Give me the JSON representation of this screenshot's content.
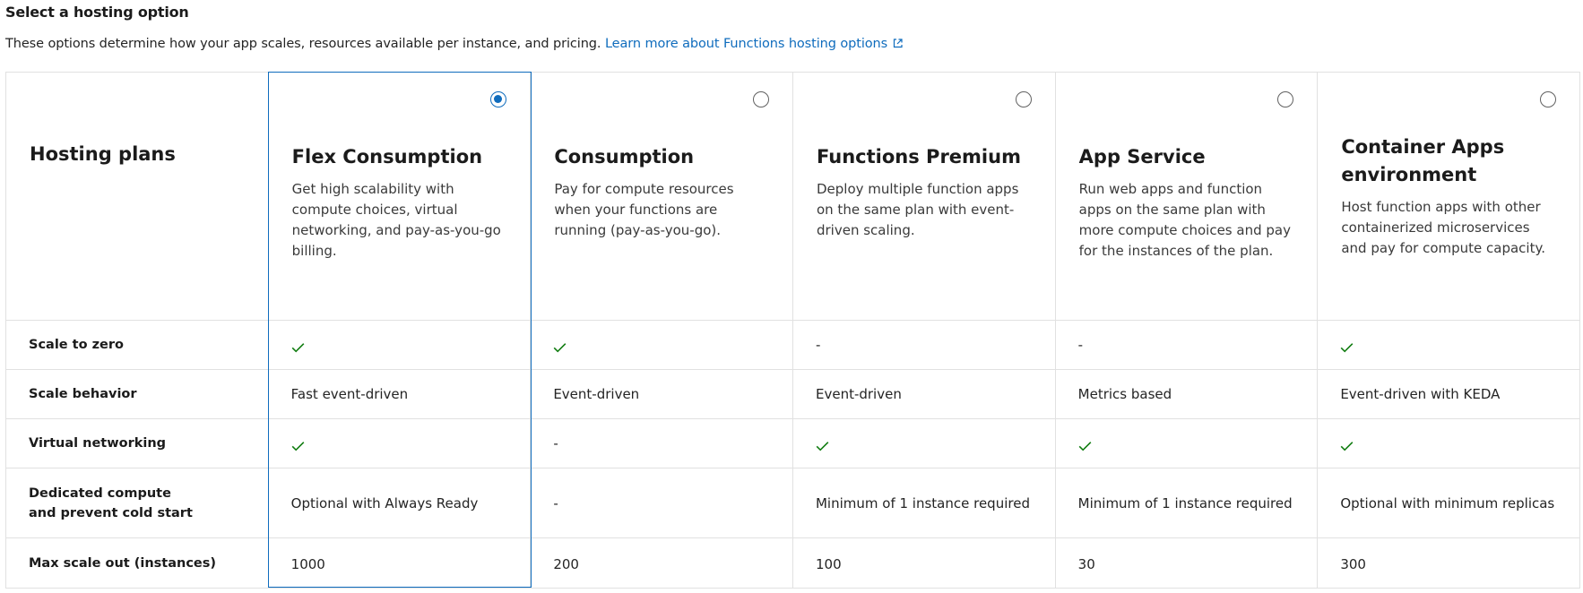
{
  "header": {
    "title": "Select a hosting option",
    "description": "These options determine how your app scales, resources available per instance, and pricing.",
    "learn_more": "Learn more about Functions hosting options"
  },
  "table": {
    "header_label": "Hosting plans",
    "row_labels": {
      "scale_to_zero": "Scale to zero",
      "scale_behavior": "Scale behavior",
      "virtual_networking": "Virtual networking",
      "dedicated_compute": "Dedicated compute and prevent cold start",
      "max_scale_out": "Max scale out (instances)"
    },
    "plans": [
      {
        "name": "Flex Consumption",
        "description": "Get high scalability with compute choices, virtual networking, and pay-as-you-go billing.",
        "selected": true,
        "scale_to_zero": "check",
        "scale_behavior": "Fast event-driven",
        "virtual_networking": "check",
        "dedicated_compute": "Optional with Always Ready",
        "max_scale_out": "1000"
      },
      {
        "name": "Consumption",
        "description": "Pay for compute resources when your functions are running (pay-as-you-go).",
        "selected": false,
        "scale_to_zero": "check",
        "scale_behavior": "Event-driven",
        "virtual_networking": "-",
        "dedicated_compute": "-",
        "max_scale_out": "200"
      },
      {
        "name": "Functions Premium",
        "description": "Deploy multiple function apps on the same plan with event-driven scaling.",
        "selected": false,
        "scale_to_zero": "-",
        "scale_behavior": "Event-driven",
        "virtual_networking": "check",
        "dedicated_compute": "Minimum of 1 instance required",
        "max_scale_out": "100"
      },
      {
        "name": "App Service",
        "description": "Run web apps and function apps on the same plan with more compute choices and pay for the instances of the plan.",
        "selected": false,
        "scale_to_zero": "-",
        "scale_behavior": "Metrics based",
        "virtual_networking": "check",
        "dedicated_compute": "Minimum of 1 instance required",
        "max_scale_out": "30"
      },
      {
        "name": "Container Apps environment",
        "description": "Host function apps with other containerized microservices and pay for compute capacity.",
        "selected": false,
        "scale_to_zero": "check",
        "scale_behavior": "Event-driven with KEDA",
        "virtual_networking": "check",
        "dedicated_compute": "Optional with minimum replicas",
        "max_scale_out": "300"
      }
    ]
  },
  "colors": {
    "accent": "#0f6cbd",
    "check": "#107c10",
    "border": "#e1e1e1"
  },
  "icons": {
    "check": "checkmark-icon",
    "external": "open-in-new-icon"
  }
}
